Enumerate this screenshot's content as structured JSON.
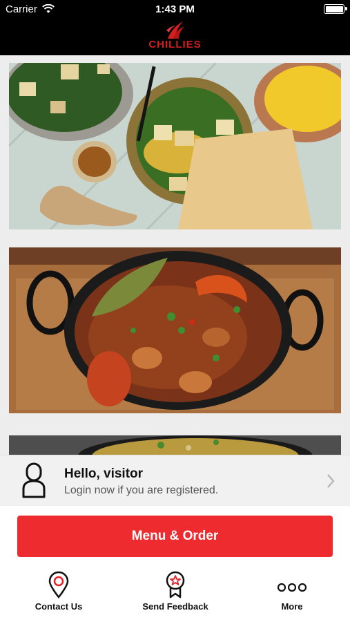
{
  "status_bar": {
    "carrier": "Carrier",
    "time": "1:43 PM"
  },
  "header": {
    "logo_text": "CHILLIES"
  },
  "tiles": [
    {
      "name": "paneer-dish-photo"
    },
    {
      "name": "curry-balti-photo"
    },
    {
      "name": "partial-dish-photo"
    }
  ],
  "login": {
    "greeting": "Hello, visitor",
    "subtitle": "Login now if you are registered."
  },
  "primary_button": {
    "label": "Menu & Order",
    "color": "#ee2c30"
  },
  "tabs": [
    {
      "label": "Contact Us",
      "icon": "map-pin-icon"
    },
    {
      "label": "Send Feedback",
      "icon": "feedback-badge-icon"
    },
    {
      "label": "More",
      "icon": "more-dots-icon"
    }
  ],
  "colors": {
    "brand": "#d41f1f",
    "header_bg": "#000000"
  }
}
